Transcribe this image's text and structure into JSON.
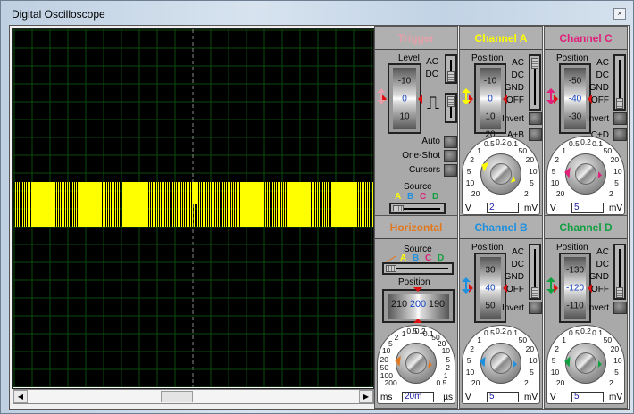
{
  "window": {
    "title": "Digital Oscilloscope",
    "close_label": "×"
  },
  "colors": {
    "trace": "#ffff00",
    "grid": "#0b4a0b",
    "marker": "#e01010"
  },
  "trigger": {
    "title": "Trigger",
    "color": "#e6a0aa",
    "level_label": "Level",
    "level_ticks": [
      "-10",
      "0",
      "10"
    ],
    "level_value": "0",
    "coupling": [
      "AC",
      "DC"
    ],
    "coupling_selected": "DC",
    "edge": "rising",
    "buttons": [
      "Auto",
      "One-Shot",
      "Cursors"
    ],
    "source_label": "Source",
    "sources": [
      {
        "label": "A",
        "color": "#ffff00"
      },
      {
        "label": "B",
        "color": "#1e90e0"
      },
      {
        "label": "C",
        "color": "#e0207a"
      },
      {
        "label": "D",
        "color": "#10a040"
      }
    ],
    "source_selected": "A"
  },
  "horizontal": {
    "title": "Horizontal",
    "color": "#e07820",
    "source_label": "Source",
    "sources": [
      {
        "label": "",
        "icon": "ramp-icon",
        "color": "#e07820"
      },
      {
        "label": "A",
        "color": "#ffff00"
      },
      {
        "label": "B",
        "color": "#1e90e0"
      },
      {
        "label": "C",
        "color": "#e0207a"
      },
      {
        "label": "D",
        "color": "#10a040"
      }
    ],
    "source_selected": "ramp",
    "position_label": "Position",
    "position_ticks": [
      "210",
      "200",
      "190"
    ],
    "position_value": "200",
    "dial_labels": [
      "200",
      "100",
      "50",
      "20",
      "10",
      "5",
      "2",
      "1",
      "0.5",
      "0.2",
      "0.1",
      "50",
      "20",
      "10",
      "5",
      "2",
      "1",
      "0.5"
    ],
    "value": "20m",
    "unit_left": "ms",
    "unit_right": "µs"
  },
  "channels": [
    {
      "title": "Channel A",
      "color": "#ffff00",
      "position_label": "Position",
      "position_ticks": [
        "-10",
        "0",
        "10",
        "20"
      ],
      "position_value": "0",
      "coupling": [
        "AC",
        "DC",
        "GND",
        "OFF"
      ],
      "coupling_selected": "AC",
      "buttons": [
        "Invert",
        "A+B"
      ],
      "dial_labels": [
        "20",
        "10",
        "5",
        "2",
        "1",
        "0.5",
        "0.2",
        "0.1",
        "50",
        "20",
        "10",
        "5",
        "2"
      ],
      "value": "2",
      "unit_left": "V",
      "unit_right": "mV"
    },
    {
      "title": "Channel C",
      "color": "#e0207a",
      "position_label": "Position",
      "position_ticks": [
        "-50",
        "-40",
        "-30"
      ],
      "position_value": "-40",
      "coupling": [
        "AC",
        "DC",
        "GND",
        "OFF"
      ],
      "coupling_selected": "OFF",
      "buttons": [
        "Invert",
        "C+D"
      ],
      "dial_labels": [
        "20",
        "10",
        "5",
        "2",
        "1",
        "0.5",
        "0.2",
        "0.1",
        "50",
        "20",
        "10",
        "5",
        "2"
      ],
      "value": "5",
      "unit_left": "V",
      "unit_right": "mV"
    },
    {
      "title": "Channel B",
      "color": "#1e90e0",
      "position_label": "Position",
      "position_ticks": [
        "30",
        "40",
        "50"
      ],
      "position_value": "40",
      "coupling": [
        "AC",
        "DC",
        "GND",
        "OFF"
      ],
      "coupling_selected": "OFF",
      "buttons": [
        "Invert"
      ],
      "dial_labels": [
        "20",
        "10",
        "5",
        "2",
        "1",
        "0.5",
        "0.2",
        "0.1",
        "50",
        "20",
        "10",
        "5",
        "2"
      ],
      "value": "5",
      "unit_left": "V",
      "unit_right": "mV"
    },
    {
      "title": "Channel D",
      "color": "#10a040",
      "position_label": "Position",
      "position_ticks": [
        "-130",
        "-120",
        "-110"
      ],
      "position_value": "-120",
      "coupling": [
        "AC",
        "DC",
        "GND",
        "OFF"
      ],
      "coupling_selected": "OFF",
      "buttons": [
        "Invert"
      ],
      "dial_labels": [
        "20",
        "10",
        "5",
        "2",
        "1",
        "0.5",
        "0.2",
        "0.1",
        "50",
        "20",
        "10",
        "5",
        "2"
      ],
      "value": "5",
      "unit_left": "V",
      "unit_right": "mV"
    }
  ]
}
